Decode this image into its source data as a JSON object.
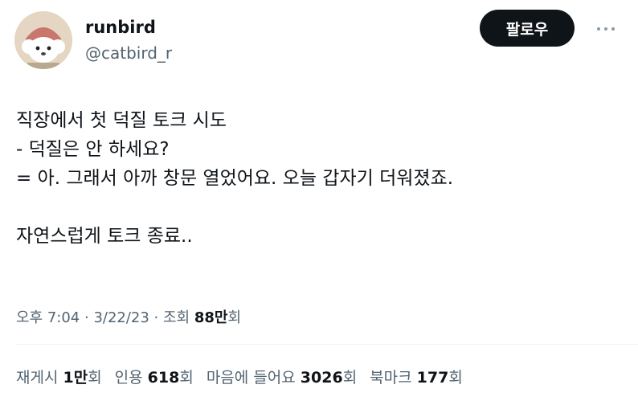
{
  "user": {
    "display_name": "runbird",
    "handle": "@catbird_r"
  },
  "follow_button": "팔로우",
  "tweet_lines": [
    "직장에서 첫 덕질 토크 시도",
    "- 덕질은 안 하세요?",
    "= 아. 그래서 아까 창문 열었어요. 오늘 갑자기 더워졌죠.",
    "",
    "자연스럽게 토크 종료.."
  ],
  "meta": {
    "time": "오후 7:04",
    "sep": " · ",
    "date": "3/22/23",
    "views_label": "조회 ",
    "views_value": "88만",
    "views_suffix": "회"
  },
  "stats": [
    {
      "label": "재게시 ",
      "value": "1만",
      "suffix": "회"
    },
    {
      "label": "인용 ",
      "value": "618",
      "suffix": "회"
    },
    {
      "label": "마음에 들어요 ",
      "value": "3026",
      "suffix": "회"
    },
    {
      "label": "북마크 ",
      "value": "177",
      "suffix": "회"
    }
  ],
  "colors": {
    "text": "#0f1419",
    "secondary": "#536471",
    "button_bg": "#0f1419",
    "button_text": "#ffffff"
  }
}
